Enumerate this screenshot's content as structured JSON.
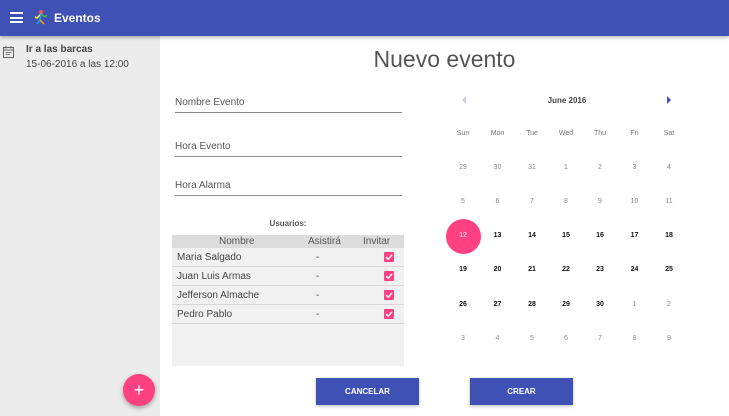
{
  "app": {
    "title": "Eventos"
  },
  "sidebar": {
    "events": [
      {
        "title": "Ir a las barcas",
        "date": "15-06-2016 a las 12:00"
      }
    ],
    "fab_label": "+"
  },
  "form": {
    "title": "Nuevo evento",
    "fields": [
      {
        "placeholder": "Nombre Evento"
      },
      {
        "placeholder": "Hora Evento"
      },
      {
        "placeholder": "Hora Alarma"
      }
    ],
    "users_label": "Usuarios:",
    "table": {
      "headers": [
        "Nombre",
        "Asistirá",
        "Invitar"
      ],
      "rows": [
        {
          "name": "Maria Salgado",
          "attend": "-",
          "invite": true
        },
        {
          "name": "Juan Luis Armas",
          "attend": "-",
          "invite": true
        },
        {
          "name": "Jefferson Almache",
          "attend": "-",
          "invite": true
        },
        {
          "name": "Pedro Pablo",
          "attend": "-",
          "invite": true
        }
      ]
    },
    "cancel_label": "CANCELAR",
    "create_label": "CREAR"
  },
  "calendar": {
    "month": "June 2016",
    "weekdays": [
      "Sun",
      "Mon",
      "Tue",
      "Wed",
      "Thu",
      "Fri",
      "Sat"
    ],
    "selected_day": "12",
    "weeks": [
      [
        "29",
        "30",
        "31",
        "1",
        "2",
        "3",
        "4"
      ],
      [
        "5",
        "6",
        "7",
        "8",
        "9",
        "10",
        "11"
      ],
      [
        "12",
        "13",
        "14",
        "15",
        "16",
        "17",
        "18"
      ],
      [
        "19",
        "20",
        "21",
        "22",
        "23",
        "24",
        "25"
      ],
      [
        "26",
        "27",
        "28",
        "29",
        "30",
        "1",
        "2"
      ],
      [
        "3",
        "4",
        "5",
        "6",
        "7",
        "8",
        "9"
      ]
    ],
    "current_month_flags": [
      [
        false,
        false,
        false,
        false,
        false,
        false,
        false
      ],
      [
        false,
        false,
        false,
        false,
        false,
        false,
        false
      ],
      [
        true,
        true,
        true,
        true,
        true,
        true,
        true
      ],
      [
        true,
        true,
        true,
        true,
        true,
        true,
        true
      ],
      [
        true,
        true,
        true,
        true,
        true,
        false,
        false
      ],
      [
        false,
        false,
        false,
        false,
        false,
        false,
        false
      ]
    ]
  },
  "colors": {
    "primary": "#3f51b5",
    "accent": "#ff4081",
    "sidebar": "#ececec"
  },
  "icons": {
    "menu": "menu-icon",
    "logo": "app-logo-icon",
    "event": "calendar-note-icon",
    "prev": "chevron-left-icon",
    "next": "chevron-right-icon",
    "check": "check-icon"
  }
}
